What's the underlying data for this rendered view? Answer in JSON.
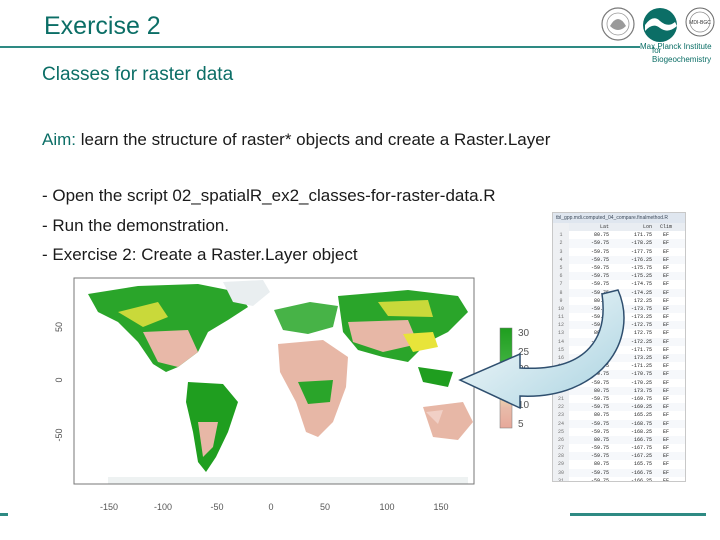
{
  "slide": {
    "title": "Exercise 2",
    "subtitle": "Classes for raster data",
    "aim_label": "Aim:",
    "aim_text": " learn the structure of raster* objects and create a Raster.Layer",
    "bullets": [
      "- Open the script 02_spatialR_ex2_classes-for-raster-data.R",
      "- Run the demonstration.",
      "- Exercise 2: Create a Raster.Layer object"
    ]
  },
  "logos": {
    "institute": "Max Planck Institute",
    "department": "for Biogeochemistry",
    "badge": "MDI-BGC"
  },
  "map": {
    "x_ticks": [
      "-150",
      "-100",
      "-50",
      "0",
      "50",
      "100",
      "150"
    ],
    "y_ticks": [
      "50",
      "0",
      "-50"
    ],
    "legend_ticks": [
      "30",
      "25",
      "20",
      "15",
      "10",
      "5"
    ],
    "colors": {
      "high": "#1f9e1f",
      "mid": "#c9d93a",
      "low": "#e7b7a6",
      "ocean": "#ffffff"
    }
  },
  "table": {
    "title": "tbl_gpp.mdi.computed_04_compare.finalmethod.R",
    "headers": [
      "",
      "Lat",
      "Lon",
      "Clim"
    ],
    "rows": [
      [
        "1",
        "80.75",
        "171.75",
        "EF"
      ],
      [
        "2",
        "-59.75",
        "-178.25",
        "EF"
      ],
      [
        "3",
        "-59.75",
        "-177.75",
        "EF"
      ],
      [
        "4",
        "-59.75",
        "-176.25",
        "EF"
      ],
      [
        "5",
        "-59.75",
        "-175.75",
        "EF"
      ],
      [
        "6",
        "-59.75",
        "-175.25",
        "EF"
      ],
      [
        "7",
        "-59.75",
        "-174.75",
        "EF"
      ],
      [
        "8",
        "-59.75",
        "-174.25",
        "EF"
      ],
      [
        "9",
        "80.75",
        "172.25",
        "EF"
      ],
      [
        "10",
        "-59.75",
        "-173.75",
        "EF"
      ],
      [
        "11",
        "-59.75",
        "-173.25",
        "EF"
      ],
      [
        "12",
        "-59.75",
        "-172.75",
        "EF"
      ],
      [
        "13",
        "80.75",
        "172.75",
        "EF"
      ],
      [
        "14",
        "-59.75",
        "-172.25",
        "EF"
      ],
      [
        "15",
        "-59.75",
        "-171.75",
        "EF"
      ],
      [
        "16",
        "80.75",
        "173.25",
        "EF"
      ],
      [
        "17",
        "-59.75",
        "-171.25",
        "EF"
      ],
      [
        "18",
        "-59.75",
        "-170.75",
        "EF"
      ],
      [
        "19",
        "-59.75",
        "-170.25",
        "EF"
      ],
      [
        "20",
        "80.75",
        "173.75",
        "EF"
      ],
      [
        "21",
        "-59.75",
        "-169.75",
        "EF"
      ],
      [
        "22",
        "-59.75",
        "-169.25",
        "EF"
      ],
      [
        "23",
        "80.75",
        "165.25",
        "EF"
      ],
      [
        "24",
        "-59.75",
        "-168.75",
        "EF"
      ],
      [
        "25",
        "-59.75",
        "-168.25",
        "EF"
      ],
      [
        "26",
        "80.75",
        "166.75",
        "EF"
      ],
      [
        "27",
        "-59.75",
        "-167.75",
        "EF"
      ],
      [
        "28",
        "-59.75",
        "-167.25",
        "EF"
      ],
      [
        "29",
        "80.75",
        "165.75",
        "EF"
      ],
      [
        "30",
        "-59.75",
        "-166.75",
        "EF"
      ],
      [
        "31",
        "-59.75",
        "-166.25",
        "EF"
      ]
    ]
  }
}
